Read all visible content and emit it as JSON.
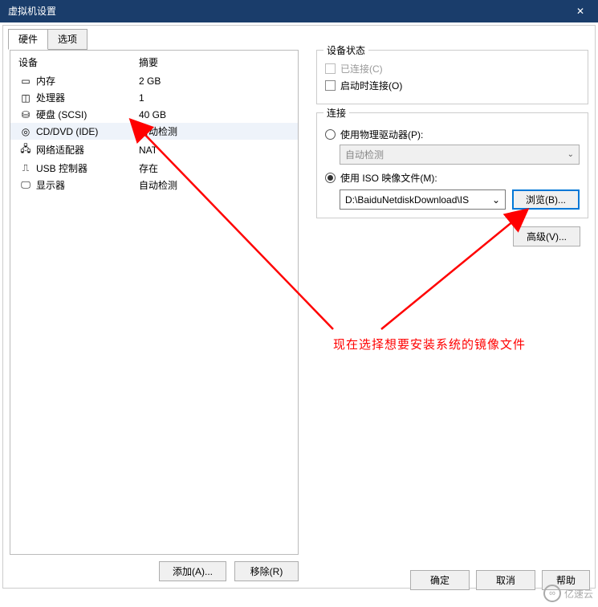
{
  "window": {
    "title": "虚拟机设置",
    "close_glyph": "✕"
  },
  "tabs": {
    "hardware": "硬件",
    "options": "选项"
  },
  "table": {
    "header_device": "设备",
    "header_summary": "摘要",
    "rows": [
      {
        "icon": "memory-icon",
        "name": "内存",
        "summary": "2 GB"
      },
      {
        "icon": "cpu-icon",
        "name": "处理器",
        "summary": "1"
      },
      {
        "icon": "hdd-icon",
        "name": "硬盘 (SCSI)",
        "summary": "40 GB"
      },
      {
        "icon": "cd-icon",
        "name": "CD/DVD (IDE)",
        "summary": "自动检测",
        "selected": true
      },
      {
        "icon": "network-icon",
        "name": "网络适配器",
        "summary": "NAT"
      },
      {
        "icon": "usb-icon",
        "name": "USB 控制器",
        "summary": "存在"
      },
      {
        "icon": "display-icon",
        "name": "显示器",
        "summary": "自动检测"
      }
    ],
    "add_btn": "添加(A)...",
    "remove_btn": "移除(R)"
  },
  "status_group": {
    "title": "设备状态",
    "connected": "已连接(C)",
    "connect_at_poweron": "启动时连接(O)"
  },
  "connection_group": {
    "title": "连接",
    "use_physical": "使用物理驱动器(P):",
    "auto_detect": "自动检测",
    "use_iso": "使用 ISO 映像文件(M):",
    "iso_path": "D:\\BaiduNetdiskDownload\\IS",
    "browse": "浏览(B)...",
    "advanced": "高级(V)..."
  },
  "dialog_buttons": {
    "ok": "确定",
    "cancel": "取消",
    "help": "帮助"
  },
  "annotation": "现在选择想要安装系统的镜像文件",
  "watermark": "亿速云",
  "arrow_dropdown": "⌄"
}
